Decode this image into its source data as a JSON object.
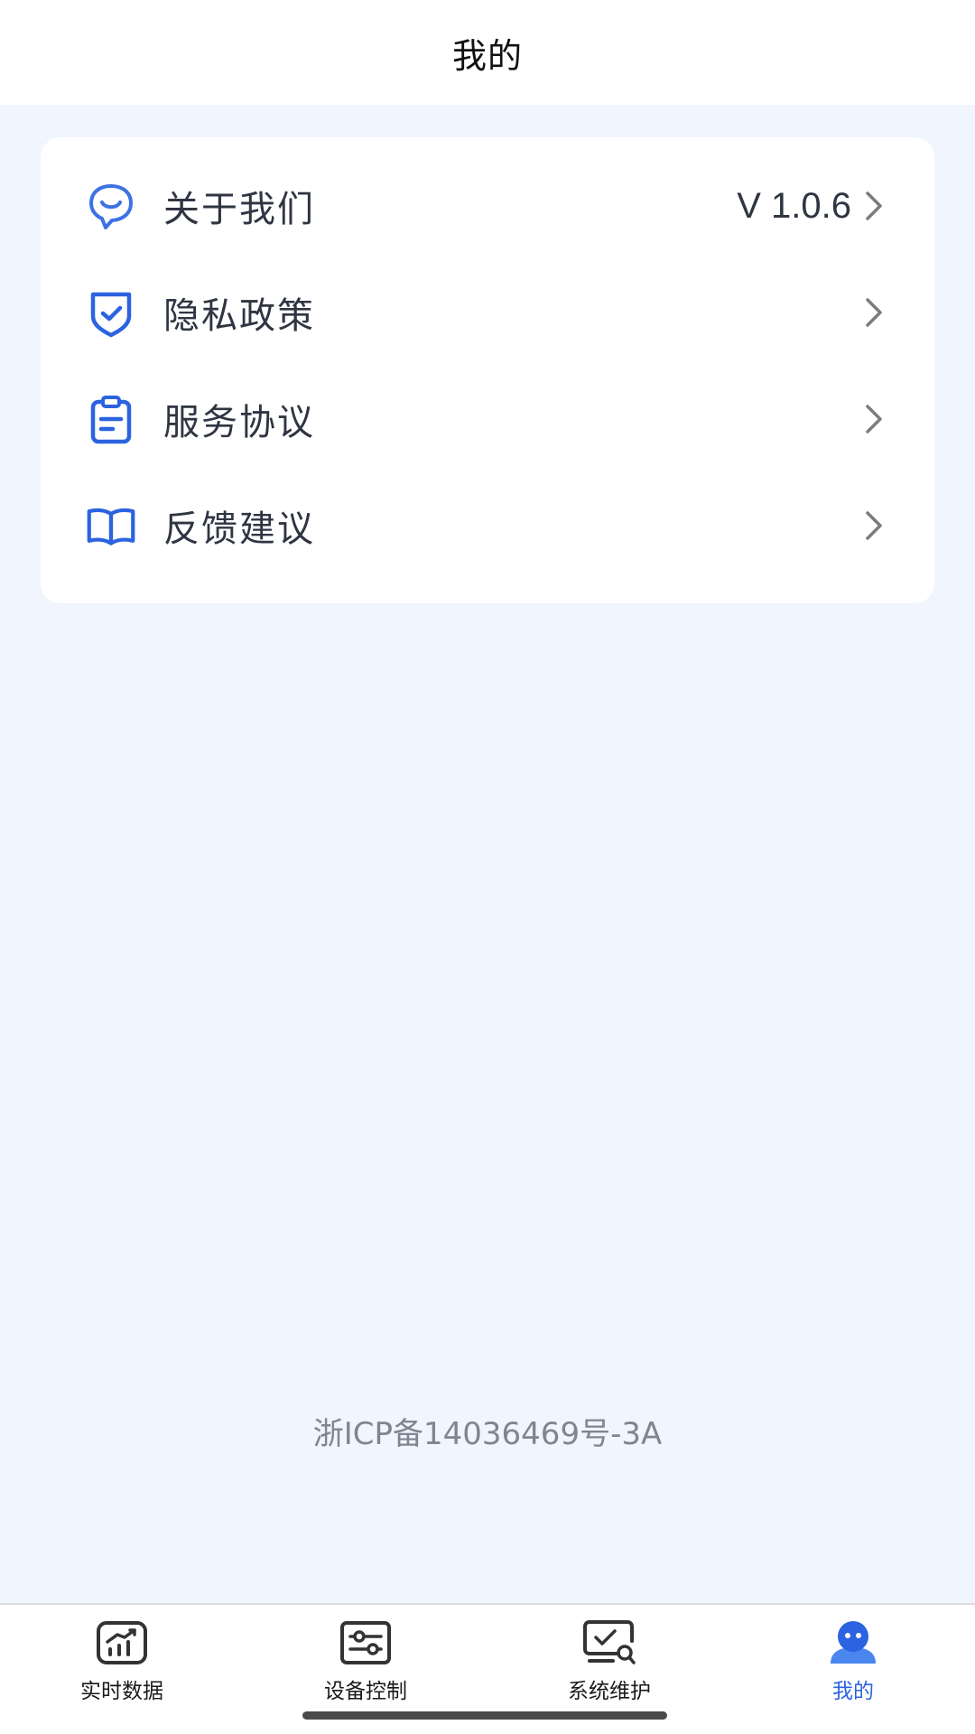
{
  "header": {
    "title": "我的"
  },
  "menu": {
    "items": [
      {
        "label": "关于我们",
        "value": "V 1.0.6",
        "icon": "chat-bubble-smile-icon"
      },
      {
        "label": "隐私政策",
        "value": "",
        "icon": "shield-check-icon"
      },
      {
        "label": "服务协议",
        "value": "",
        "icon": "clipboard-icon"
      },
      {
        "label": "反馈建议",
        "value": "",
        "icon": "open-book-icon"
      }
    ]
  },
  "footer": {
    "icp": "浙ICP备14036469号-3A"
  },
  "tabbar": {
    "tabs": [
      {
        "label": "实时数据",
        "icon": "realtime-chart-icon",
        "active": false
      },
      {
        "label": "设备控制",
        "icon": "sliders-control-icon",
        "active": false
      },
      {
        "label": "系统维护",
        "icon": "monitor-search-icon",
        "active": false
      },
      {
        "label": "我的",
        "icon": "user-profile-icon",
        "active": true
      }
    ]
  },
  "colors": {
    "accent": "#2b63e0",
    "page_background": "#f0f5fe",
    "text_primary": "#2f3542",
    "text_secondary": "#7f8591"
  }
}
